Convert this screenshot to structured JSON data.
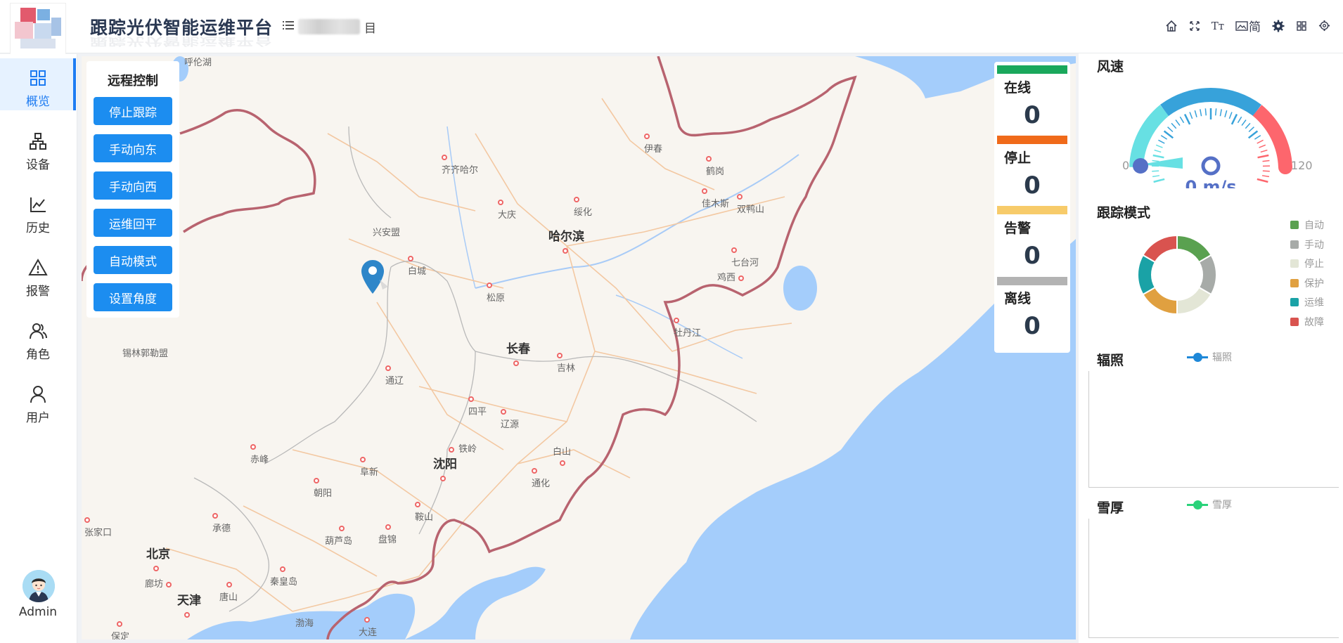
{
  "header": {
    "title": "跟踪光伏智能运维平台",
    "project_suffix": "目",
    "tools": [
      {
        "name": "home-icon",
        "glyph": "⌂"
      },
      {
        "name": "fullscreen-icon",
        "glyph": "⤧"
      },
      {
        "name": "font-size-icon",
        "glyph": "Tт"
      },
      {
        "name": "language-icon",
        "glyph": "简"
      },
      {
        "name": "theme-gear-icon",
        "glyph": "⚙"
      },
      {
        "name": "layout-grid-icon",
        "glyph": "▦"
      },
      {
        "name": "settings-icon",
        "glyph": "⚙"
      }
    ]
  },
  "sidebar": {
    "items": [
      {
        "label": "概览",
        "icon": "grid-icon",
        "active": true
      },
      {
        "label": "设备",
        "icon": "device-tree-icon"
      },
      {
        "label": "历史",
        "icon": "history-chart-icon"
      },
      {
        "label": "报警",
        "icon": "alarm-warning-icon"
      },
      {
        "label": "角色",
        "icon": "role-users-icon"
      },
      {
        "label": "用户",
        "icon": "user-icon"
      }
    ],
    "user_name": "Admin"
  },
  "remote_control": {
    "title": "远程控制",
    "buttons": [
      "停止跟踪",
      "手动向东",
      "手动向西",
      "运维回平",
      "自动模式",
      "设置角度"
    ]
  },
  "status": {
    "items": [
      {
        "label": "在线",
        "value": "0",
        "color": "#1aa85c"
      },
      {
        "label": "停止",
        "value": "0",
        "color": "#f06a1a"
      },
      {
        "label": "告警",
        "value": "0",
        "color": "#f7cb6a"
      },
      {
        "label": "离线",
        "value": "0",
        "color": "#b3b3b3"
      }
    ]
  },
  "map": {
    "cities": [
      {
        "name": "呼伦湖",
        "big": false,
        "dot": false
      },
      {
        "name": "齐齐哈尔",
        "big": false,
        "dot": true
      },
      {
        "name": "伊春",
        "big": false,
        "dot": true
      },
      {
        "name": "鹤岗",
        "big": false,
        "dot": true
      },
      {
        "name": "大庆",
        "big": false,
        "dot": true
      },
      {
        "name": "绥化",
        "big": false,
        "dot": true
      },
      {
        "name": "佳木斯",
        "big": false,
        "dot": true
      },
      {
        "name": "双鸭山",
        "big": false,
        "dot": true
      },
      {
        "name": "兴安盟",
        "big": false,
        "dot": false
      },
      {
        "name": "哈尔滨",
        "big": true,
        "dot": true
      },
      {
        "name": "白城",
        "big": false,
        "dot": true
      },
      {
        "name": "七台河",
        "big": false,
        "dot": true
      },
      {
        "name": "鸡西",
        "big": false,
        "dot": true
      },
      {
        "name": "松原",
        "big": false,
        "dot": true
      },
      {
        "name": "牡丹江",
        "big": false,
        "dot": true
      },
      {
        "name": "锡林郭勒盟",
        "big": false,
        "dot": false
      },
      {
        "name": "长春",
        "big": true,
        "dot": true
      },
      {
        "name": "吉林",
        "big": false,
        "dot": true
      },
      {
        "name": "通辽",
        "big": false,
        "dot": true
      },
      {
        "name": "四平",
        "big": false,
        "dot": true
      },
      {
        "name": "辽源",
        "big": false,
        "dot": true
      },
      {
        "name": "铁岭",
        "big": false,
        "dot": true
      },
      {
        "name": "赤峰",
        "big": false,
        "dot": true
      },
      {
        "name": "阜新",
        "big": false,
        "dot": true
      },
      {
        "name": "沈阳",
        "big": true,
        "dot": true
      },
      {
        "name": "白山",
        "big": false,
        "dot": true
      },
      {
        "name": "朝阳",
        "big": false,
        "dot": true
      },
      {
        "name": "通化",
        "big": false,
        "dot": true
      },
      {
        "name": "张家口",
        "big": false,
        "dot": true
      },
      {
        "name": "承德",
        "big": false,
        "dot": true
      },
      {
        "name": "葫芦岛",
        "big": false,
        "dot": true
      },
      {
        "name": "盘锦",
        "big": false,
        "dot": true
      },
      {
        "name": "鞍山",
        "big": false,
        "dot": true
      },
      {
        "name": "北京",
        "big": true,
        "dot": true
      },
      {
        "name": "廊坊",
        "big": false,
        "dot": true
      },
      {
        "name": "秦皇岛",
        "big": false,
        "dot": true
      },
      {
        "name": "唐山",
        "big": false,
        "dot": true
      },
      {
        "name": "天津",
        "big": true,
        "dot": true
      },
      {
        "name": "渤海",
        "big": false,
        "dot": false
      },
      {
        "name": "保定",
        "big": false,
        "dot": true
      },
      {
        "name": "大连",
        "big": false,
        "dot": true
      }
    ]
  },
  "wind": {
    "title": "风速",
    "value": 0,
    "min_label": "0",
    "max_label": "120",
    "readout": "0 m/s",
    "colors": [
      "#67e0e3",
      "#37a2da",
      "#fd666d"
    ]
  },
  "tracking_mode": {
    "title": "跟踪模式",
    "legend": [
      {
        "label": "自动",
        "color": "#5aa150"
      },
      {
        "label": "手动",
        "color": "#a7aba8"
      },
      {
        "label": "停止",
        "color": "#e3e6d6"
      },
      {
        "label": "保护",
        "color": "#e0a040"
      },
      {
        "label": "运维",
        "color": "#1aa2a6"
      },
      {
        "label": "故障",
        "color": "#d9534f"
      }
    ]
  },
  "radiation": {
    "title": "辐照",
    "legend": "辐照",
    "color": "#1e88d8"
  },
  "snow": {
    "title": "雪厚",
    "legend": "雪厚",
    "color": "#2ad27a"
  }
}
